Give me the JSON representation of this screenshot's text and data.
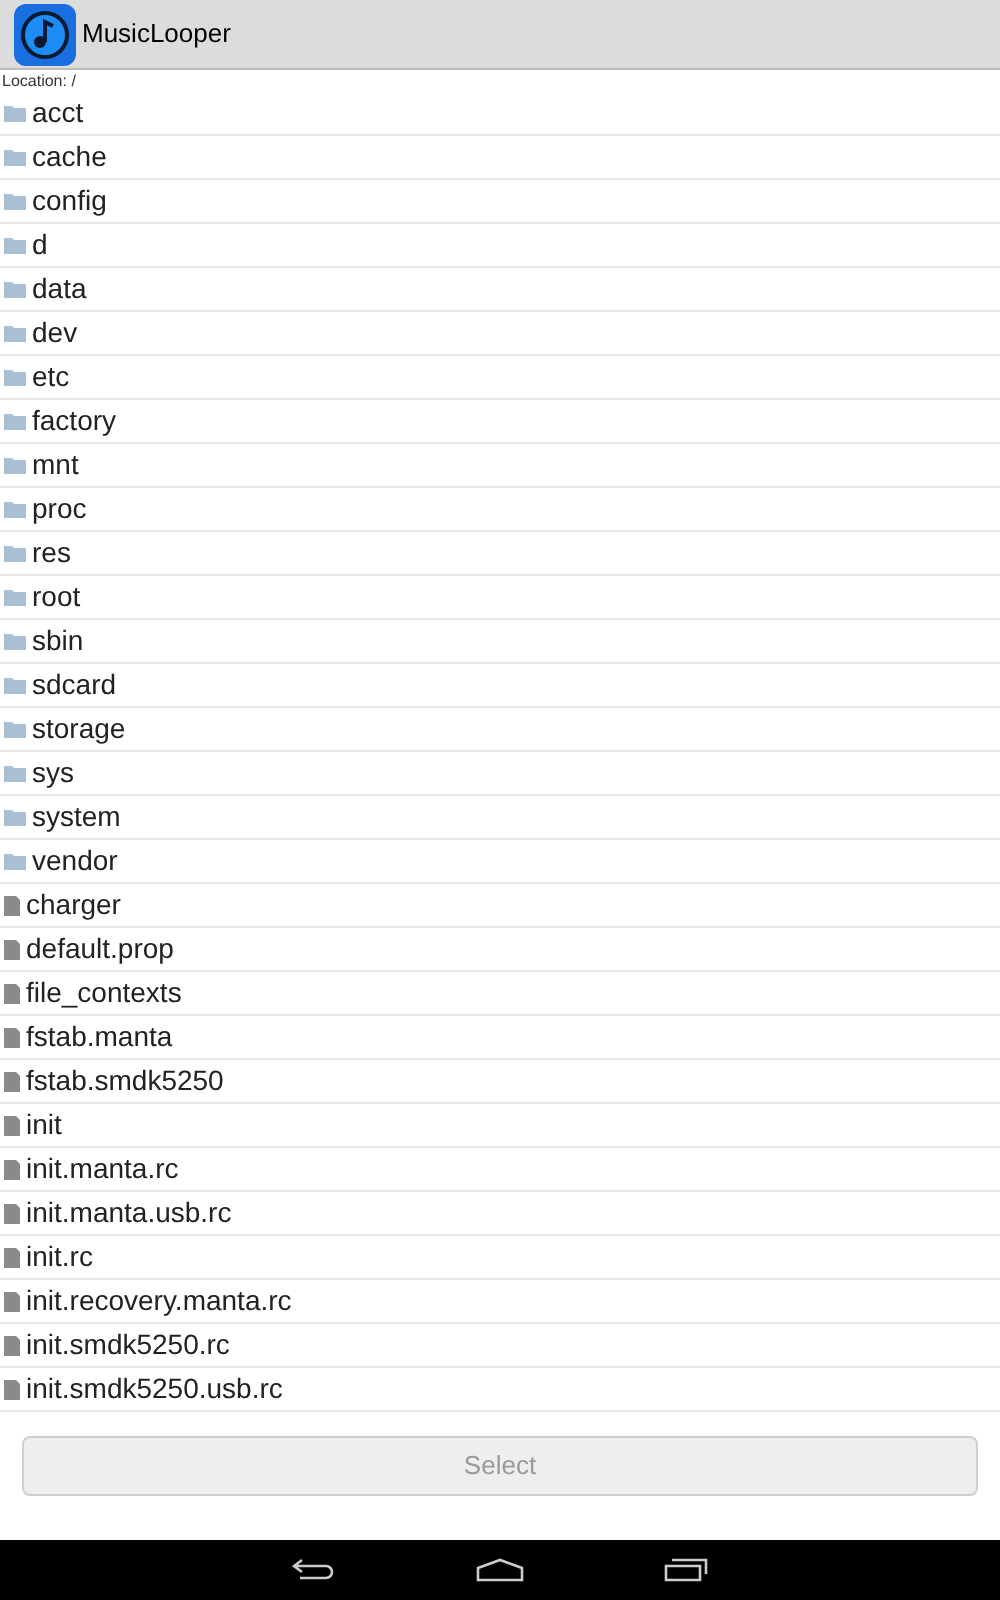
{
  "app_bar": {
    "title": "MusicLooper"
  },
  "location": "Location: /",
  "items": [
    {
      "name": "acct",
      "kind": "folder"
    },
    {
      "name": "cache",
      "kind": "folder"
    },
    {
      "name": "config",
      "kind": "folder"
    },
    {
      "name": "d",
      "kind": "folder"
    },
    {
      "name": "data",
      "kind": "folder"
    },
    {
      "name": "dev",
      "kind": "folder"
    },
    {
      "name": "etc",
      "kind": "folder"
    },
    {
      "name": "factory",
      "kind": "folder"
    },
    {
      "name": "mnt",
      "kind": "folder"
    },
    {
      "name": "proc",
      "kind": "folder"
    },
    {
      "name": "res",
      "kind": "folder"
    },
    {
      "name": "root",
      "kind": "folder"
    },
    {
      "name": "sbin",
      "kind": "folder"
    },
    {
      "name": "sdcard",
      "kind": "folder"
    },
    {
      "name": "storage",
      "kind": "folder"
    },
    {
      "name": "sys",
      "kind": "folder"
    },
    {
      "name": "system",
      "kind": "folder"
    },
    {
      "name": "vendor",
      "kind": "folder"
    },
    {
      "name": "charger",
      "kind": "file"
    },
    {
      "name": "default.prop",
      "kind": "file"
    },
    {
      "name": "file_contexts",
      "kind": "file"
    },
    {
      "name": "fstab.manta",
      "kind": "file"
    },
    {
      "name": "fstab.smdk5250",
      "kind": "file"
    },
    {
      "name": "init",
      "kind": "file"
    },
    {
      "name": "init.manta.rc",
      "kind": "file"
    },
    {
      "name": "init.manta.usb.rc",
      "kind": "file"
    },
    {
      "name": "init.rc",
      "kind": "file"
    },
    {
      "name": "init.recovery.manta.rc",
      "kind": "file"
    },
    {
      "name": "init.smdk5250.rc",
      "kind": "file"
    },
    {
      "name": "init.smdk5250.usb.rc",
      "kind": "file"
    }
  ],
  "select_button": {
    "label": "Select",
    "disabled": true
  }
}
